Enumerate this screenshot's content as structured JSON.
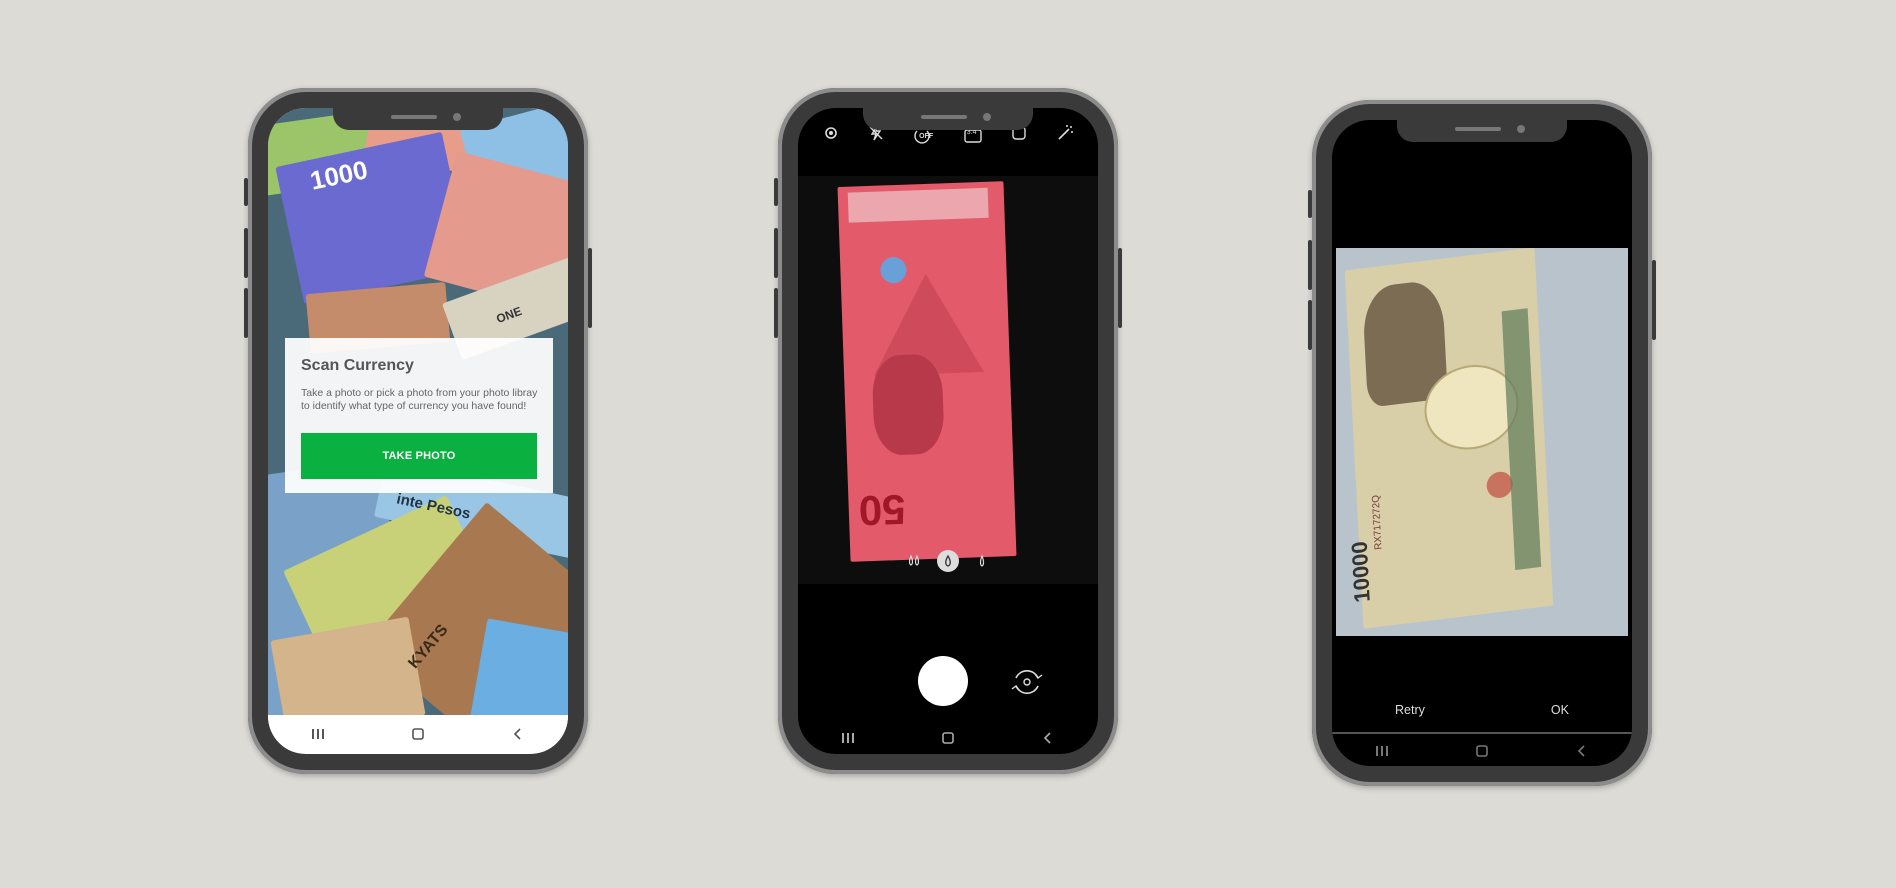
{
  "phone1": {
    "card_title": "Scan Currency",
    "card_description": "Take a photo or pick a photo from your photo libray to identify what type of currency you have found!",
    "take_photo_label": "TAKE PHOTO",
    "banknote_texts": [
      "1000",
      "inte Pesos",
      "KYATS",
      "ONE"
    ]
  },
  "phone2": {
    "toolbar_icons": [
      "settings-icon",
      "flash-off-icon",
      "timer-off-icon",
      "ratio-icon",
      "motion-icon",
      "effects-icon"
    ],
    "timer_label": "OFF",
    "ratio_label": "3:4",
    "banknote_number": "50",
    "filters": [
      "filter-1-icon",
      "filter-2-icon",
      "filter-3-icon"
    ]
  },
  "phone3": {
    "banknote_number": "10000",
    "serial": "RX717272Q",
    "retry_label": "Retry",
    "ok_label": "OK"
  },
  "nav_icons": [
    "recents-icon",
    "home-icon",
    "back-icon"
  ],
  "colors": {
    "accent": "#0ab040",
    "background": "#dcdbd6",
    "frame": "#3a3a3a"
  }
}
